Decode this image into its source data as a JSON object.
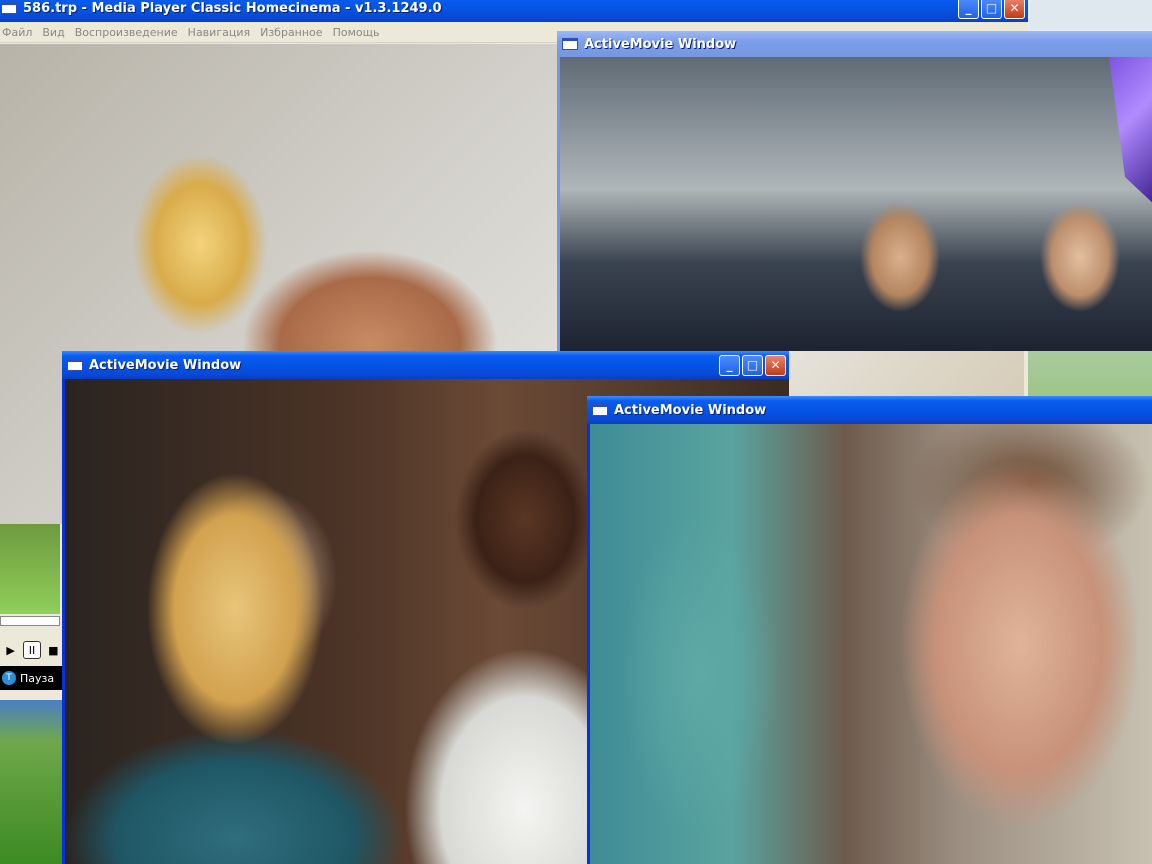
{
  "mpc": {
    "title": "586.trp - Media Player Classic Homecinema - v1.3.1249.0",
    "menu": [
      "Файл",
      "Вид",
      "Воспроизведение",
      "Навигация",
      "Избранное",
      "Помощь"
    ],
    "status": "Пауза",
    "controls": {
      "play": "▶",
      "pause": "II",
      "stop": "■"
    }
  },
  "windows": [
    {
      "title": "ActiveMovie Window"
    },
    {
      "title": "ActiveMovie Window"
    },
    {
      "title": "ActiveMovie Window"
    }
  ],
  "caption_buttons": {
    "minimize": "_",
    "maximize": "□",
    "close": "✕"
  }
}
